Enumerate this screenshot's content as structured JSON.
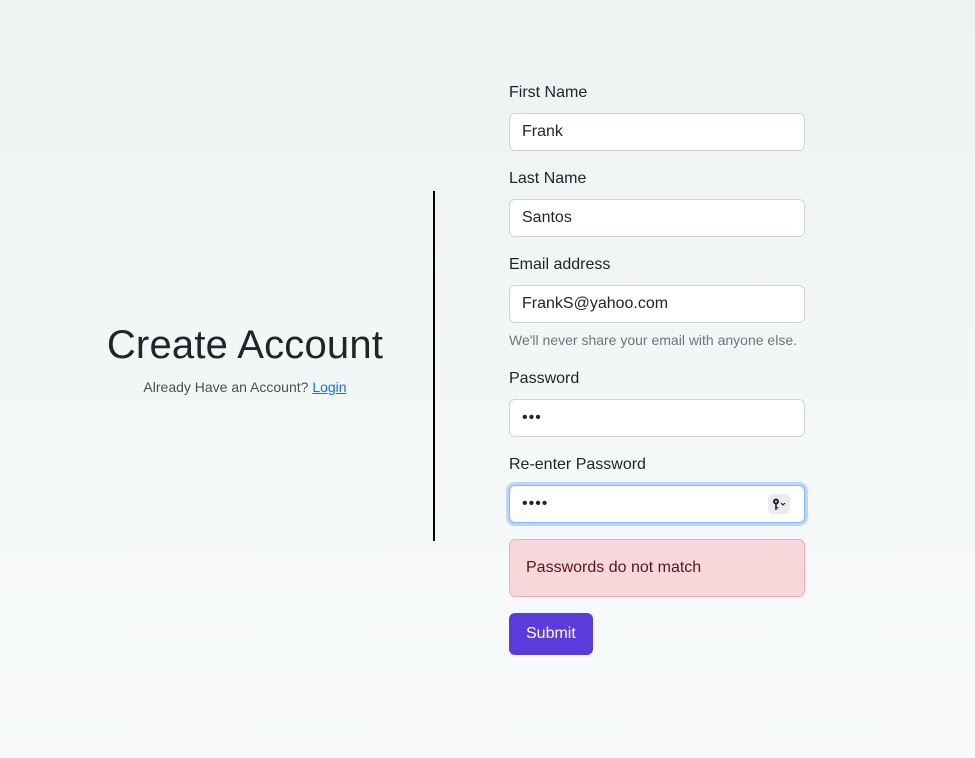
{
  "header": {
    "title": "Create Account",
    "login_prompt": "Already Have an Account?",
    "login_link": "Login"
  },
  "form": {
    "first_name": {
      "label": "First Name",
      "value": "Frank"
    },
    "last_name": {
      "label": "Last Name",
      "value": "Santos"
    },
    "email": {
      "label": "Email address",
      "value": "FrankS@yahoo.com",
      "help": "We'll never share your email with anyone else."
    },
    "password": {
      "label": "Password",
      "masked_value": "•••"
    },
    "confirm_password": {
      "label": "Re-enter Password",
      "masked_value": "••••"
    },
    "error": "Passwords do not match",
    "submit_label": "Submit"
  },
  "icons": {
    "password_manager": "key-icon"
  },
  "colors": {
    "submit_button": "#5b3bdc",
    "alert_background": "#f8d7da",
    "link": "#0d6efd"
  }
}
